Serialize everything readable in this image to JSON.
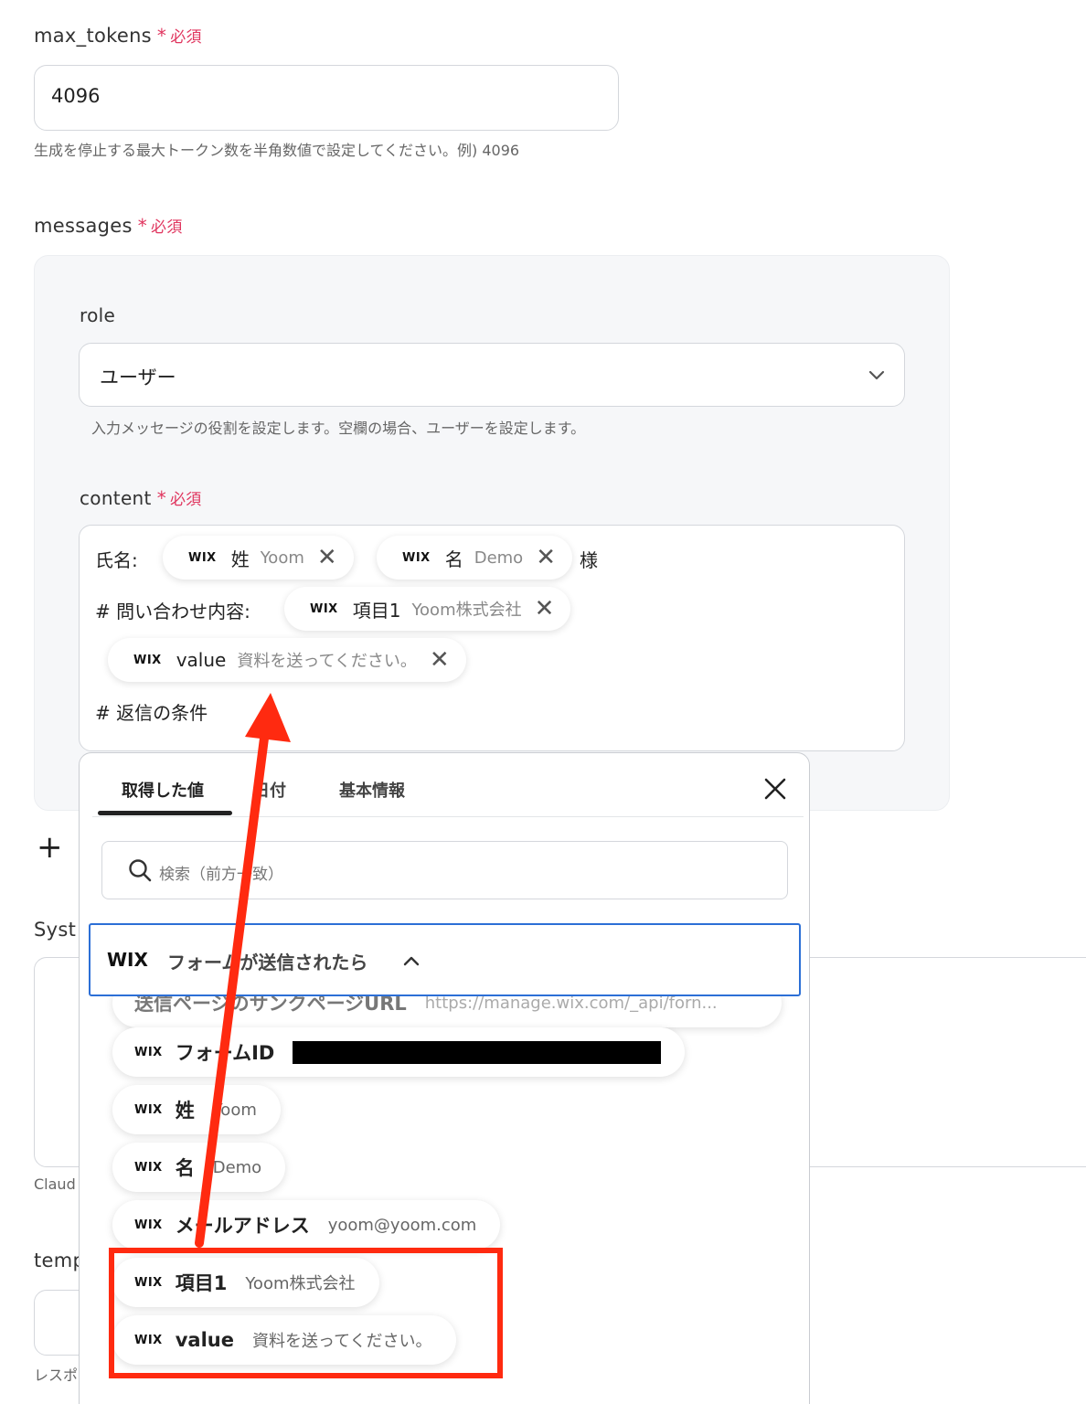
{
  "max_tokens": {
    "label": "max_tokens",
    "required_star": "*",
    "required": "必須",
    "value": "4096",
    "hint": "生成を停止する最大トークン数を半角数値で設定してください。例) 4096"
  },
  "messages": {
    "label": "messages",
    "required_star": "*",
    "required": "必須",
    "role": {
      "label": "role",
      "value": "ユーザー",
      "hint": "入力メッセージの役割を設定します。空欄の場合、ユーザーを設定します。"
    },
    "content": {
      "label": "content",
      "required_star": "*",
      "required": "必須",
      "line1_prefix": "氏名:",
      "line1_suffix": "様",
      "line2_prefix": "# 問い合わせ内容:",
      "line4": "# 返信の条件",
      "chips": [
        {
          "brand": "WIX",
          "name": "姓",
          "value": "Yoom",
          "remove": "✕"
        },
        {
          "brand": "WIX",
          "name": "名",
          "value": "Demo",
          "remove": "✕"
        },
        {
          "brand": "WIX",
          "name": "項目1",
          "value": "Yoom株式会社",
          "remove": "✕"
        },
        {
          "brand": "WIX",
          "name": "value",
          "value": "資料を送ってください。",
          "remove": "✕"
        }
      ]
    },
    "add_icon": "+"
  },
  "background_fields": {
    "system_label": "Syst",
    "claude_hint": "Claud",
    "temp_label": "temp",
    "response_hint": "レスポ"
  },
  "picker": {
    "tabs": [
      "取得した値",
      "日付",
      "基本情報"
    ],
    "active_tab": 0,
    "close_icon": "✕",
    "search_placeholder": "検索（前方一致）",
    "group": {
      "brand": "WIX",
      "title": "フォームが送信されたら"
    },
    "partial_item": {
      "name": "送信ページのサンクページURL",
      "value": "https://manage.wix.com/_api/forn..."
    },
    "items": [
      {
        "brand": "WIX",
        "name": "フォームID",
        "value": ""
      },
      {
        "brand": "WIX",
        "name": "姓",
        "value": "Yoom"
      },
      {
        "brand": "WIX",
        "name": "名",
        "value": "Demo"
      },
      {
        "brand": "WIX",
        "name": "メールアドレス",
        "value": "yoom@yoom.com"
      },
      {
        "brand": "WIX",
        "name": "項目1",
        "value": "Yoom株式会社"
      },
      {
        "brand": "WIX",
        "name": "value",
        "value": "資料を送ってください。"
      }
    ]
  },
  "colors": {
    "required": "#e0365f",
    "annotation": "#ff2a10",
    "group_border": "#2c6fd6"
  }
}
